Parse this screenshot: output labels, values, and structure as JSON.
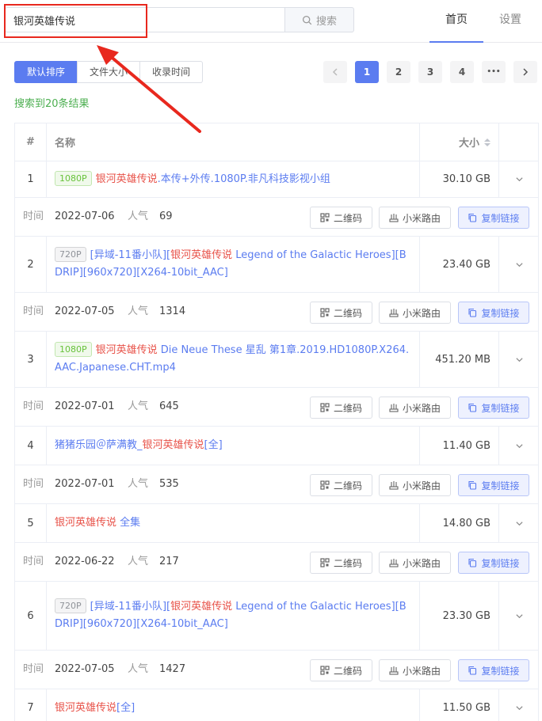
{
  "search": {
    "value": "银河英雄传说",
    "button_label": "搜索"
  },
  "nav": {
    "home": "首页",
    "settings": "设置"
  },
  "sort": {
    "default": "默认排序",
    "size": "文件大小",
    "time": "收录时间"
  },
  "pager": {
    "pages": [
      "1",
      "2",
      "3",
      "4"
    ],
    "more": "•••",
    "current": "1"
  },
  "result_count": "搜索到20条结果",
  "table": {
    "headers": {
      "index": "#",
      "name": "名称",
      "size": "大小"
    },
    "labels": {
      "time": "时间",
      "popularity": "人气",
      "qr": "二维码",
      "router": "小米路由",
      "copy": "复制链接"
    },
    "rows": [
      {
        "index": "1",
        "tag": "1080P",
        "hl": "银河英雄传说",
        "rest": ".本传+外传.1080P.非凡科技影视小组",
        "size": "30.10 GB",
        "date": "2022-07-06",
        "pop": "69"
      },
      {
        "index": "2",
        "tag": "720P",
        "pre": "[异域-11番小队][",
        "hl": "银河英雄传说",
        "rest": " Legend of the Galactic Heroes][BDRIP][960x720][X264-10bit_AAC]",
        "size": "23.40 GB",
        "date": "2022-07-05",
        "pop": "1314"
      },
      {
        "index": "3",
        "tag": "1080P",
        "hl": "银河英雄传说",
        "rest": " Die Neue These 星乱 第1章.2019.HD1080P.X264.AAC.Japanese.CHT.mp4",
        "size": "451.20 MB",
        "date": "2022-07-01",
        "pop": "645"
      },
      {
        "index": "4",
        "pre": "猪猪乐园＠萨满教_",
        "hl": "银河英雄传说",
        "rest": "[全]",
        "size": "11.40 GB",
        "date": "2022-07-01",
        "pop": "535"
      },
      {
        "index": "5",
        "hl": "银河英雄传说",
        "rest": " 全集",
        "size": "14.80 GB",
        "date": "2022-06-22",
        "pop": "217"
      },
      {
        "index": "6",
        "tag": "720P",
        "pre": "[异域-11番小队][",
        "hl": "银河英雄传说",
        "rest": " Legend of the Galactic Heroes][BDRIP][960x720][X264-10bit_AAC]",
        "size": "23.30 GB",
        "date": "2022-07-05",
        "pop": "1427"
      },
      {
        "index": "7",
        "hl": "银河英雄传说",
        "rest": "[全]",
        "size": "11.50 GB"
      }
    ]
  },
  "colors": {
    "accent": "#5b7cf0",
    "highlight": "#e8534a",
    "annotation": "#e8281e",
    "success": "#4caf50"
  }
}
